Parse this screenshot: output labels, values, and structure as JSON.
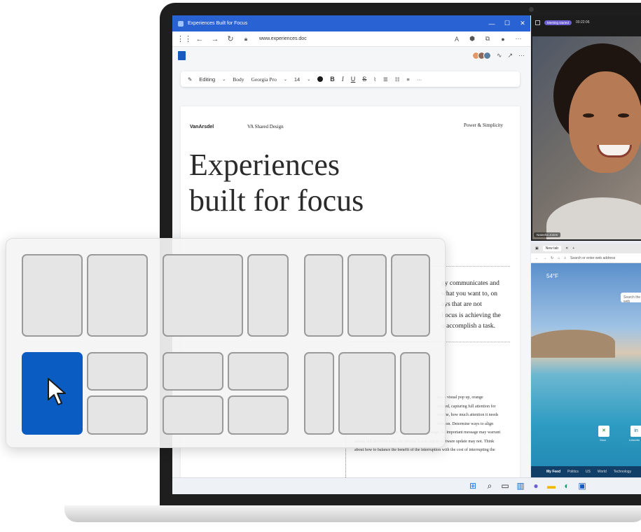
{
  "window": {
    "title": "Experiences Built for Focus",
    "controls": [
      "—",
      "☐",
      "✕"
    ]
  },
  "address": {
    "url": "www.experiences.doc"
  },
  "ribbon": {
    "mode": "Editing",
    "style": "Body",
    "font": "Georgia Pro",
    "size": "14",
    "bold": "B",
    "italic": "I",
    "underline": "U",
    "strike": "S",
    "more": "···"
  },
  "document": {
    "brand": "VanArsdel",
    "shared": "VA Shared Design",
    "tagline": "Power & Simplicity",
    "headline_line1": "Experiences",
    "headline_line2": "built for focus",
    "paragraph_lines": [
      "gy communicates and",
      "what you want to, on",
      "ays that are not",
      "Focus is achieving the",
      "o accomplish a task."
    ],
    "small_lines": [
      "tes: a visual pop up, orange",
      "needed, capturing full attention for",
      "",
      "",
      "ermine, how much attention it needs",
      "ttention. Determine ways to align",
      "the delivery form with the urgency of the message. As important message may warrant",
      "taking full attention from the person. A non-urgent software update may not. Think",
      "about how to balance the benefit of the interruption with the cost of interrupting the"
    ]
  },
  "call": {
    "pill": "Meeting started",
    "time": "00:22:06",
    "participant": "Natasha Jones"
  },
  "edge": {
    "tab": "New tab",
    "address_placeholder": "Search or enter web address",
    "weather": "54°F",
    "search": "Search the web",
    "tiles": [
      {
        "label": "Xbox",
        "icon": "xbox-icon"
      },
      {
        "label": "LinkedIn",
        "icon": "linkedin-icon"
      }
    ],
    "feed": [
      "My Feed",
      "Politics",
      "US",
      "World",
      "Technology"
    ]
  },
  "colors": {
    "accent": "#0b5cc2",
    "titlebar": "#2862d3"
  }
}
